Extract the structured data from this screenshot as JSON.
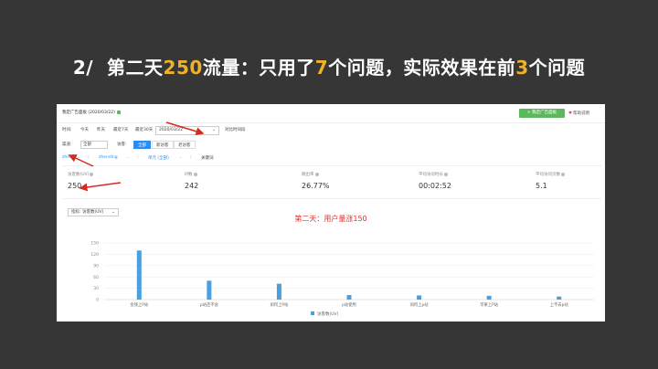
{
  "slide": {
    "prefix": "2/",
    "seg1": "第二天",
    "hl1": "250",
    "seg2": "流量：只用了",
    "hl2": "7",
    "seg3": "个问题，实际效果在前",
    "hl3": "3",
    "seg4": "个问题"
  },
  "app": {
    "title": "我定广告面板 (2020/03/22)",
    "add_button": "+ 我定广告面板",
    "help_link": "帮助说明"
  },
  "filters": {
    "time_label": "时间:",
    "time_options": [
      "今天",
      "昨天",
      "最近7天",
      "最近30天"
    ],
    "date_value": "2020/03/22",
    "compare_label": "对比时间段",
    "channel_label": "渠道:",
    "channel_value": "全部",
    "visitor_label": "访客:",
    "visitor_options": [
      "全部",
      "新访客",
      "老访客"
    ],
    "active_visitor": "全部"
  },
  "breadcrumb": {
    "items": [
      "zhihu",
      "zhending",
      "单元 (全部)"
    ],
    "extra": "关键词"
  },
  "stats": [
    {
      "label": "访客数(UV)",
      "value": "250"
    },
    {
      "label": "IP数",
      "value": "242"
    },
    {
      "label": "跳出率",
      "value": "26.77%"
    },
    {
      "label": "平均访问时长",
      "value": "00:02:52"
    },
    {
      "label": "平均访问页数",
      "value": "5.1"
    }
  ],
  "metric_select": {
    "label": "指标:",
    "value": "访客数(UV)"
  },
  "chart_data": {
    "type": "bar",
    "title": "第二天：用户量涨150",
    "categories": [
      "金钱上P站",
      "p站还不会",
      "如何上P站",
      "p站使用",
      "如何上p站",
      "苹果上P站",
      "上不去p站"
    ],
    "series": [
      {
        "name": "访客数(UV)",
        "values": [
          130,
          50,
          42,
          12,
          11,
          10,
          8
        ]
      }
    ],
    "yticks": [
      0,
      30,
      60,
      90,
      120,
      150
    ],
    "ylim": [
      0,
      150
    ],
    "color": "#4a9fe0",
    "grid": true,
    "legend": "bottom"
  }
}
